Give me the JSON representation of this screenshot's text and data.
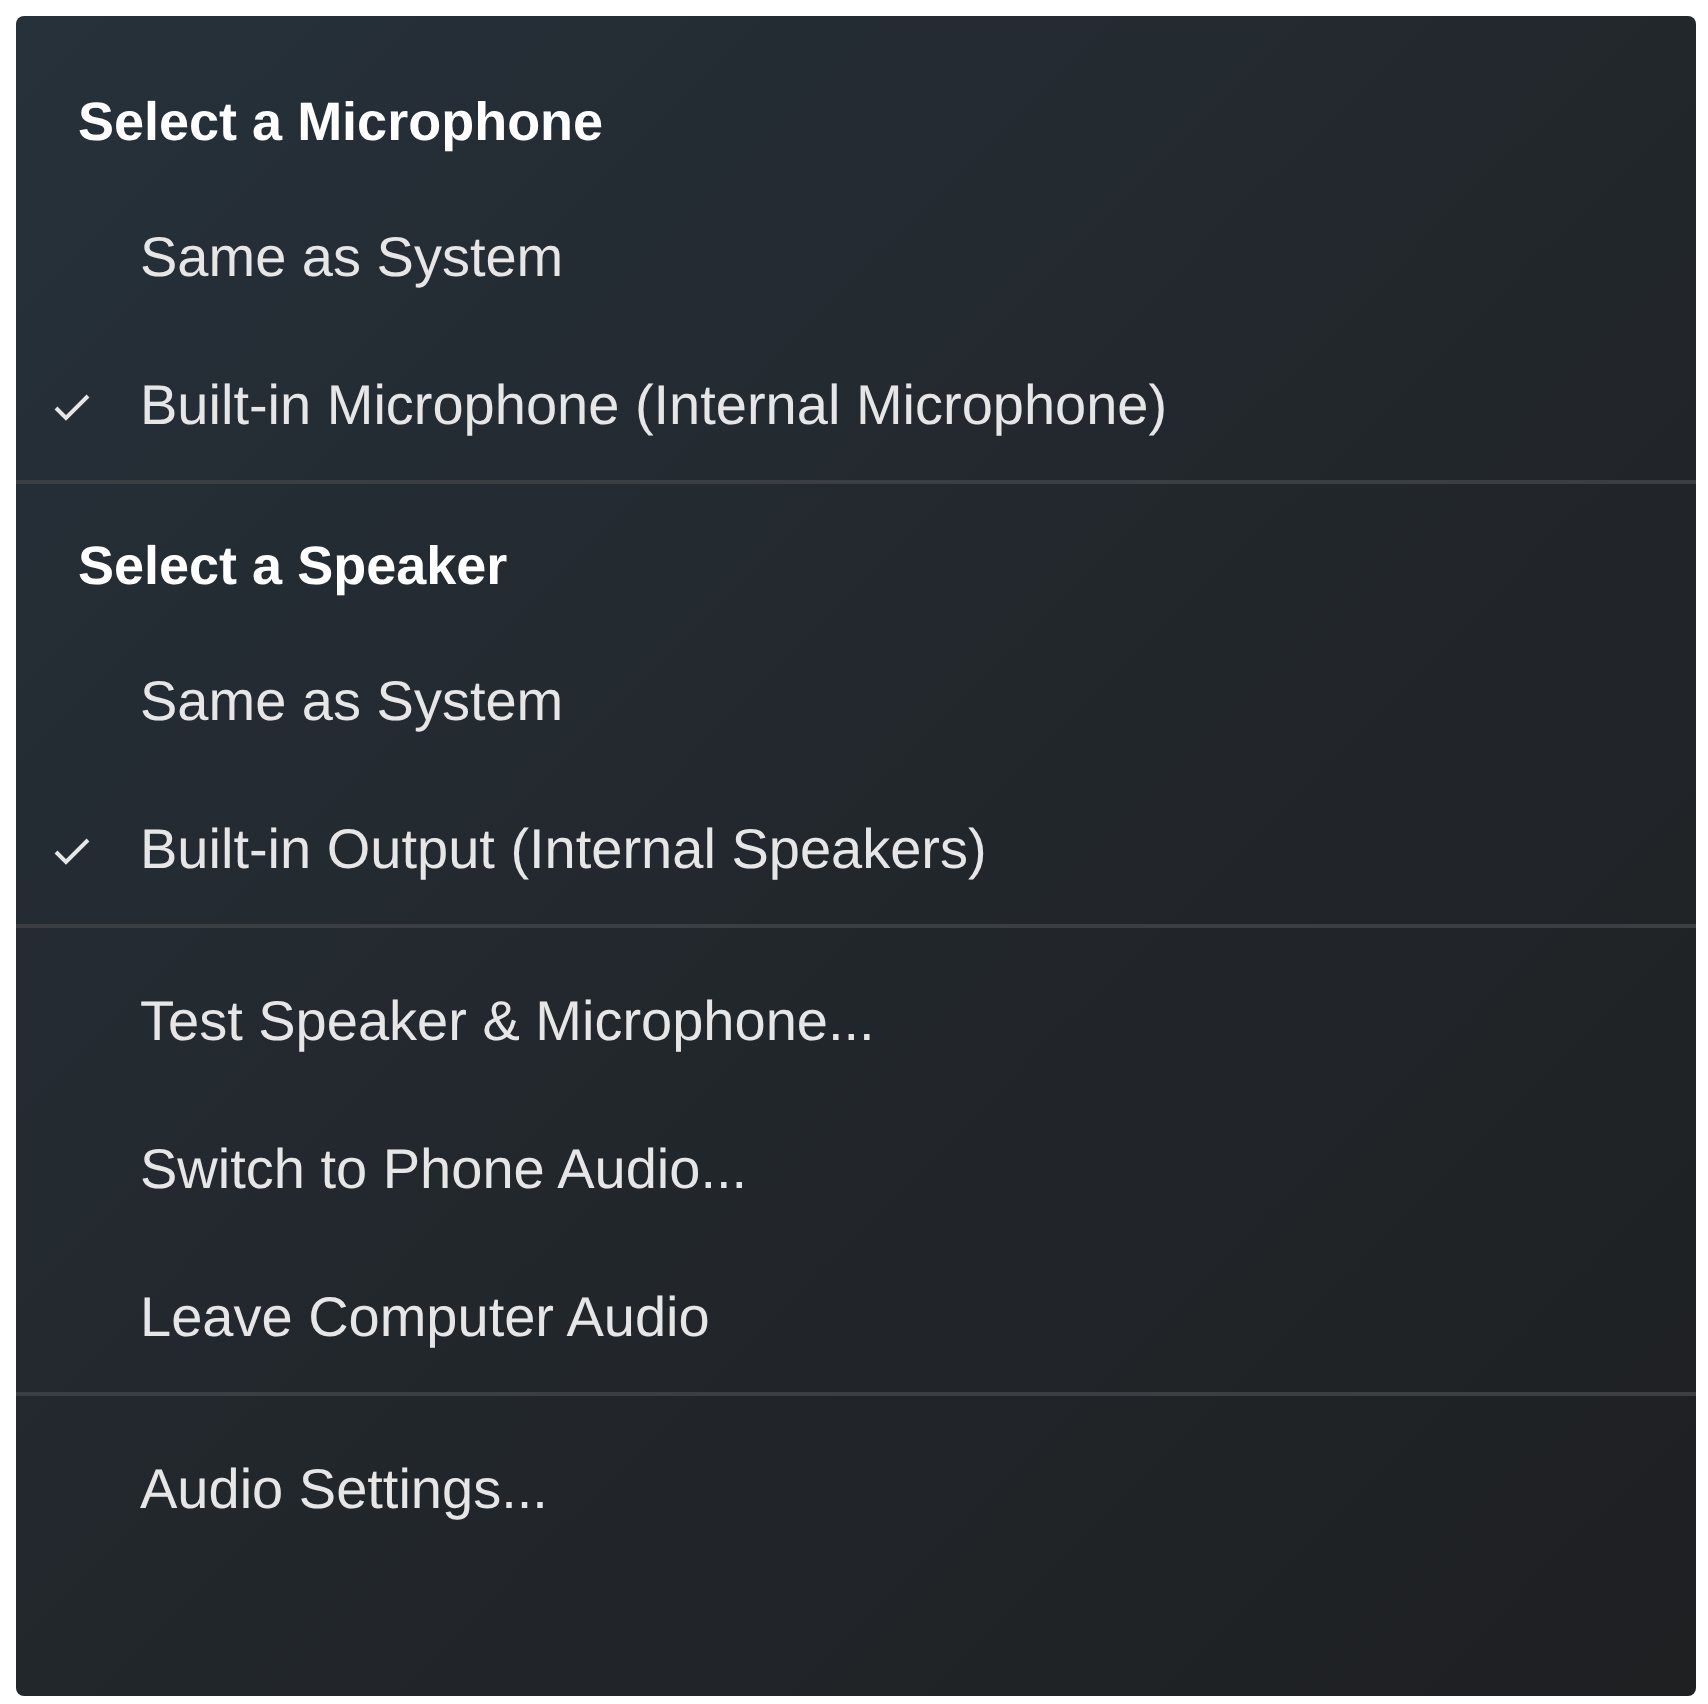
{
  "sections": [
    {
      "header": "Select a Microphone",
      "items": [
        {
          "label": "Same as System",
          "checked": false
        },
        {
          "label": "Built-in Microphone (Internal Microphone)",
          "checked": true
        }
      ]
    },
    {
      "header": "Select a Speaker",
      "items": [
        {
          "label": "Same as System",
          "checked": false
        },
        {
          "label": "Built-in Output (Internal Speakers)",
          "checked": true
        }
      ]
    },
    {
      "items": [
        {
          "label": "Test Speaker & Microphone...",
          "checked": false
        },
        {
          "label": "Switch to Phone Audio...",
          "checked": false
        },
        {
          "label": "Leave Computer Audio",
          "checked": false
        }
      ]
    },
    {
      "items": [
        {
          "label": "Audio Settings...",
          "checked": false
        }
      ]
    }
  ]
}
